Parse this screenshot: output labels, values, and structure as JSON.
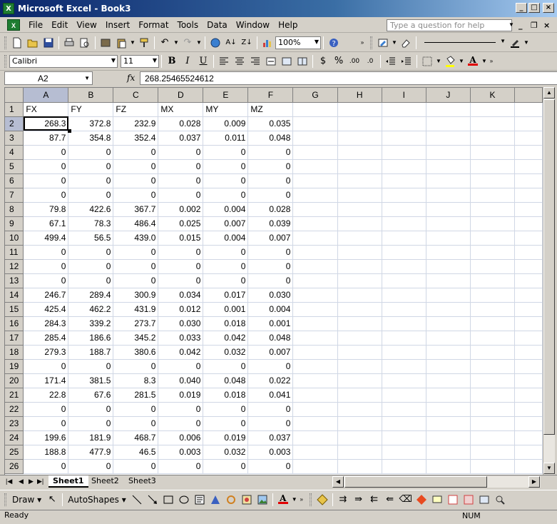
{
  "window": {
    "title": "Microsoft Excel - Book3"
  },
  "menu": [
    "File",
    "Edit",
    "View",
    "Insert",
    "Format",
    "Tools",
    "Data",
    "Window",
    "Help"
  ],
  "help_placeholder": "Type a question for help",
  "toolbar": {
    "zoom": "100%"
  },
  "format_toolbar": {
    "font": "Calibri",
    "size": "11",
    "bold": "B",
    "italic": "I",
    "underline": "U",
    "currency": "$",
    "percent": "%"
  },
  "formula_bar": {
    "name_box": "A2",
    "fx": "fx",
    "formula": "268.25465524612"
  },
  "columns": [
    "A",
    "B",
    "C",
    "D",
    "E",
    "F",
    "G",
    "H",
    "I",
    "J",
    "K"
  ],
  "rows": [
    {
      "n": "1",
      "cells": [
        "FX",
        "FY",
        "FZ",
        "MX",
        "MY",
        "MZ"
      ]
    },
    {
      "n": "2",
      "cells": [
        "268.3",
        "372.8",
        "232.9",
        "0.028",
        "0.009",
        "0.035"
      ]
    },
    {
      "n": "3",
      "cells": [
        "87.7",
        "354.8",
        "352.4",
        "0.037",
        "0.011",
        "0.048"
      ]
    },
    {
      "n": "4",
      "cells": [
        "0",
        "0",
        "0",
        "0",
        "0",
        "0"
      ]
    },
    {
      "n": "5",
      "cells": [
        "0",
        "0",
        "0",
        "0",
        "0",
        "0"
      ]
    },
    {
      "n": "6",
      "cells": [
        "0",
        "0",
        "0",
        "0",
        "0",
        "0"
      ]
    },
    {
      "n": "7",
      "cells": [
        "0",
        "0",
        "0",
        "0",
        "0",
        "0"
      ]
    },
    {
      "n": "8",
      "cells": [
        "79.8",
        "422.6",
        "367.7",
        "0.002",
        "0.004",
        "0.028"
      ]
    },
    {
      "n": "9",
      "cells": [
        "67.1",
        "78.3",
        "486.4",
        "0.025",
        "0.007",
        "0.039"
      ]
    },
    {
      "n": "10",
      "cells": [
        "499.4",
        "56.5",
        "439.0",
        "0.015",
        "0.004",
        "0.007"
      ]
    },
    {
      "n": "11",
      "cells": [
        "0",
        "0",
        "0",
        "0",
        "0",
        "0"
      ]
    },
    {
      "n": "12",
      "cells": [
        "0",
        "0",
        "0",
        "0",
        "0",
        "0"
      ]
    },
    {
      "n": "13",
      "cells": [
        "0",
        "0",
        "0",
        "0",
        "0",
        "0"
      ]
    },
    {
      "n": "14",
      "cells": [
        "246.7",
        "289.4",
        "300.9",
        "0.034",
        "0.017",
        "0.030"
      ]
    },
    {
      "n": "15",
      "cells": [
        "425.4",
        "462.2",
        "431.9",
        "0.012",
        "0.001",
        "0.004"
      ]
    },
    {
      "n": "16",
      "cells": [
        "284.3",
        "339.2",
        "273.7",
        "0.030",
        "0.018",
        "0.001"
      ]
    },
    {
      "n": "17",
      "cells": [
        "285.4",
        "186.6",
        "345.2",
        "0.033",
        "0.042",
        "0.048"
      ]
    },
    {
      "n": "18",
      "cells": [
        "279.3",
        "188.7",
        "380.6",
        "0.042",
        "0.032",
        "0.007"
      ]
    },
    {
      "n": "19",
      "cells": [
        "0",
        "0",
        "0",
        "0",
        "0",
        "0"
      ]
    },
    {
      "n": "20",
      "cells": [
        "171.4",
        "381.5",
        "8.3",
        "0.040",
        "0.048",
        "0.022"
      ]
    },
    {
      "n": "21",
      "cells": [
        "22.8",
        "67.6",
        "281.5",
        "0.019",
        "0.018",
        "0.041"
      ]
    },
    {
      "n": "22",
      "cells": [
        "0",
        "0",
        "0",
        "0",
        "0",
        "0"
      ]
    },
    {
      "n": "23",
      "cells": [
        "0",
        "0",
        "0",
        "0",
        "0",
        "0"
      ]
    },
    {
      "n": "24",
      "cells": [
        "199.6",
        "181.9",
        "468.7",
        "0.006",
        "0.019",
        "0.037"
      ]
    },
    {
      "n": "25",
      "cells": [
        "188.8",
        "477.9",
        "46.5",
        "0.003",
        "0.032",
        "0.003"
      ]
    },
    {
      "n": "26",
      "cells": [
        "0",
        "0",
        "0",
        "0",
        "0",
        "0"
      ]
    }
  ],
  "sheets": [
    "Sheet1",
    "Sheet2",
    "Sheet3"
  ],
  "drawing": {
    "draw": "Draw",
    "autoshapes": "AutoShapes"
  },
  "status": {
    "text": "Ready",
    "num": "NUM"
  }
}
